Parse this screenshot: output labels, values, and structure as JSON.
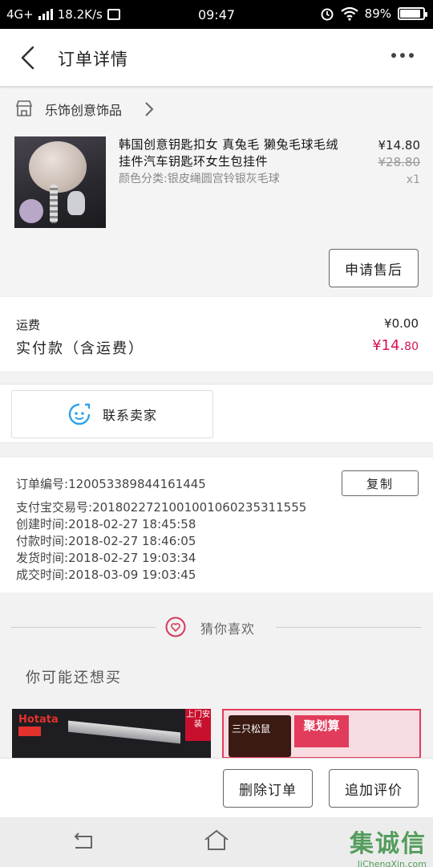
{
  "status_bar": {
    "network": "4G+",
    "speed": "18.2K/s",
    "time": "09:47",
    "battery": "89%",
    "battery_level": 0.89
  },
  "header": {
    "title": "订单详情"
  },
  "shop": {
    "name": "乐饰创意饰品"
  },
  "product": {
    "title": "韩国创意钥匙扣女 真兔毛 獭兔毛球毛绒挂件汽车钥匙环女生包挂件",
    "spec": "颜色分类:银皮绳圆宫铃银灰毛球",
    "price": "¥14.80",
    "original_price": "¥28.80",
    "quantity": "x1",
    "after_sale_label": "申请售后"
  },
  "fees": {
    "shipping_label": "运费",
    "shipping_value": "¥0.00",
    "paid_label": "实付款（含运费）",
    "paid_value_main": "¥14.",
    "paid_value_cents": "80"
  },
  "contact": {
    "label": "联系卖家"
  },
  "order_info": {
    "copy_label": "复制",
    "rows": [
      {
        "label": "订单编号:",
        "value": "120053389844161445"
      },
      {
        "label": "支付宝交易号:",
        "value": "2018022721001001060235311555"
      },
      {
        "label": "创建时间:",
        "value": "2018-02-27 18:45:58"
      },
      {
        "label": "付款时间:",
        "value": "2018-02-27 18:46:05"
      },
      {
        "label": "发货时间:",
        "value": "2018-02-27 19:03:34"
      },
      {
        "label": "成交时间:",
        "value": "2018-03-09 19:03:45"
      }
    ]
  },
  "recommend": {
    "title": "猜你喜欢",
    "subtitle": "你可能还想买",
    "card1_brand": "Hotata",
    "card1_tag": "上门安装",
    "card2_brand": "三只松鼠",
    "card2_promo": "聚划算"
  },
  "actions": {
    "delete_label": "删除订单",
    "review_label": "追加评价"
  },
  "watermark": {
    "big": "集诚信",
    "small": "JiChengXin.com"
  },
  "colors": {
    "price_accent": "#d4145a",
    "heart_accent": "#d63a5b",
    "smile_accent": "#2ea3e6"
  }
}
